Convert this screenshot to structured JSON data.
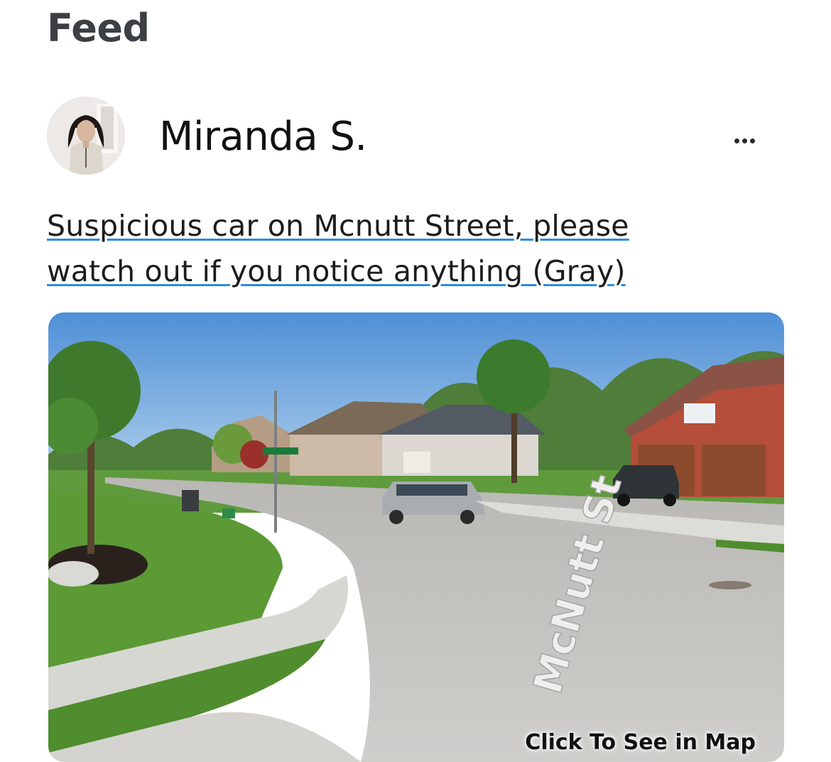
{
  "header": {
    "title": "Feed"
  },
  "post": {
    "author": {
      "name": "Miranda S."
    },
    "text": "Suspicious car on Mcnutt Street, please watch out if you notice anything (Gray)",
    "media": {
      "map_link_label": "Click To See in Map",
      "street_sign_text": "McNutt St"
    }
  },
  "colors": {
    "underline": "#2b8be0",
    "title": "#3c3f43"
  }
}
